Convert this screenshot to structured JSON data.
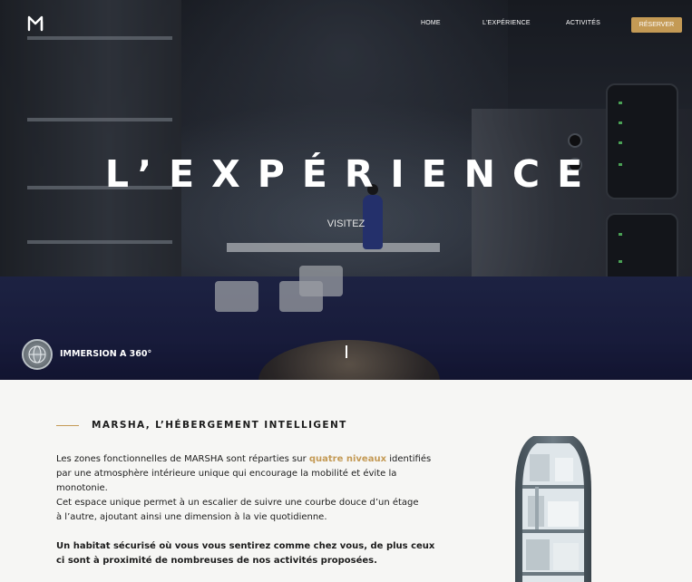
{
  "nav": {
    "logo_icon": "marsha-logo-icon",
    "links": [
      "HOME",
      "L'EXPÉRIENCE",
      "ACTIVITÉS"
    ],
    "reserve_label": "RÉSERVER"
  },
  "hero": {
    "title": "L’EXPÉRIENCE",
    "visit_label": "VISITEZ",
    "immersion_label": "IMMERSION A 360°"
  },
  "section": {
    "title": "MARSHA, L’HÉBERGEMENT INTELLIGENT",
    "p1_before": "Les zones fonctionnelles de MARSHA sont réparties sur ",
    "p1_accent": "quatre niveaux",
    "p1_after": " identifiés par une atmosphère intérieure unique qui encourage la mobilité et évite la monotonie.",
    "p2": "Cet espace unique permet à un escalier de suivre une courbe douce d’un étage à l’autre, ajoutant ainsi une dimension à la vie quotidienne.",
    "p3": "Un habitat sécurisé où vous vous sentirez comme chez vous, de plus ceux ci sont à proximité de nombreuses de nos activités proposées."
  },
  "colors": {
    "accent": "#c49a55",
    "text": "#1c1c1c",
    "background": "#f6f6f4"
  }
}
